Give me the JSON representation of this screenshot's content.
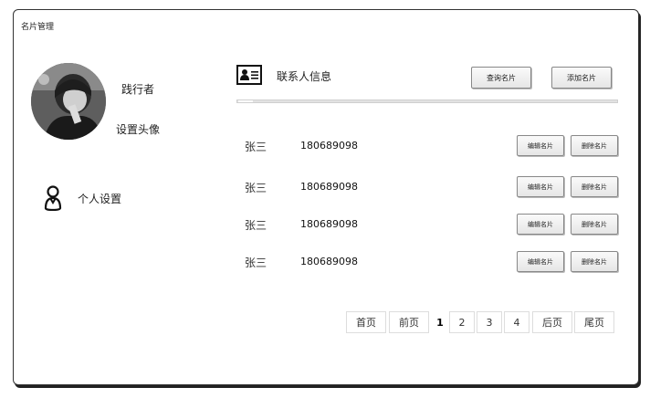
{
  "window": {
    "title": "名片管理"
  },
  "sidebar": {
    "username": "践行者",
    "set_avatar": "设置头像",
    "personal_settings": "个人设置"
  },
  "header": {
    "title": "联系人信息",
    "query_button": "查询名片",
    "add_button": "添加名片"
  },
  "contacts": [
    {
      "name": "张三",
      "phone": "180689098",
      "edit": "编辑名片",
      "delete": "删除名片"
    },
    {
      "name": "张三",
      "phone": "180689098",
      "edit": "编辑名片",
      "delete": "删除名片"
    },
    {
      "name": "张三",
      "phone": "180689098",
      "edit": "编辑名片",
      "delete": "删除名片"
    },
    {
      "name": "张三",
      "phone": "180689098",
      "edit": "编辑名片",
      "delete": "删除名片"
    }
  ],
  "pagination": {
    "first": "首页",
    "prev": "前页",
    "pages": [
      "1",
      "2",
      "3",
      "4"
    ],
    "current": "1",
    "next": "后页",
    "last": "尾页"
  }
}
